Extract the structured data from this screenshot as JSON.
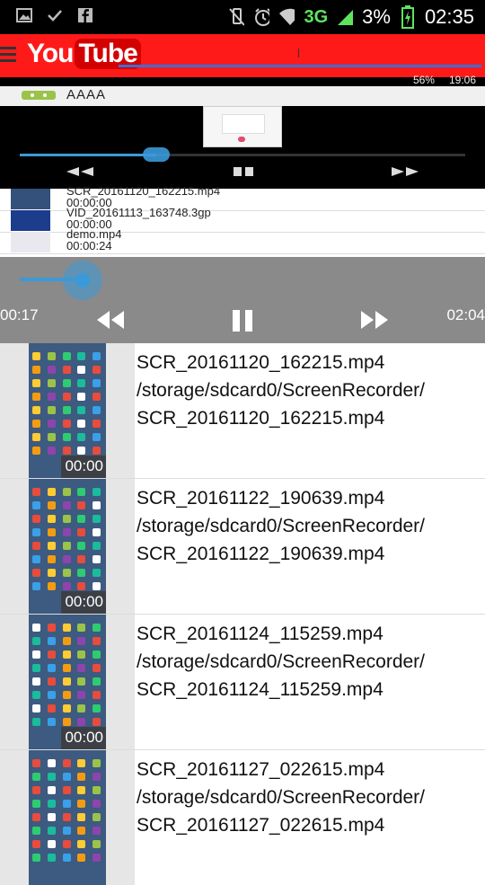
{
  "status_bar": {
    "network": "3G",
    "battery": "3%",
    "time": "02:35"
  },
  "youtube_bar": {
    "logo_you": "You",
    "logo_tube": "Tube"
  },
  "background_app": {
    "status_battery": "56%",
    "status_time": "19:06",
    "title": "AAAA",
    "files": [
      {
        "name": "SCR_20161120_162215.mp4",
        "duration": "00:00:00"
      },
      {
        "name": "VID_20161113_163748.3gp",
        "duration": "00:00:00"
      },
      {
        "name": "demo.mp4",
        "duration": "00:00:24"
      }
    ]
  },
  "player": {
    "elapsed": "00:17",
    "total": "02:04",
    "progress": 0.137
  },
  "videos": [
    {
      "name": "SCR_20161120_162215.mp4",
      "path": "/storage/sdcard0/ScreenRecorder/",
      "file": "SCR_20161120_162215.mp4",
      "duration": "00:00"
    },
    {
      "name": "SCR_20161122_190639.mp4",
      "path": "/storage/sdcard0/ScreenRecorder/",
      "file": "SCR_20161122_190639.mp4",
      "duration": "00:00"
    },
    {
      "name": "SCR_20161124_115259.mp4",
      "path": "/storage/sdcard0/ScreenRecorder/",
      "file": "SCR_20161124_115259.mp4",
      "duration": "00:00"
    },
    {
      "name": "SCR_20161127_022615.mp4",
      "path": "/storage/sdcard0/ScreenRecorder/",
      "file": "SCR_20161127_022615.mp4",
      "duration": ""
    }
  ],
  "colors": {
    "youtube_red": "#ff1a1a",
    "accent_blue": "#3a9ad9",
    "player_gray": "#8a8a8a"
  }
}
